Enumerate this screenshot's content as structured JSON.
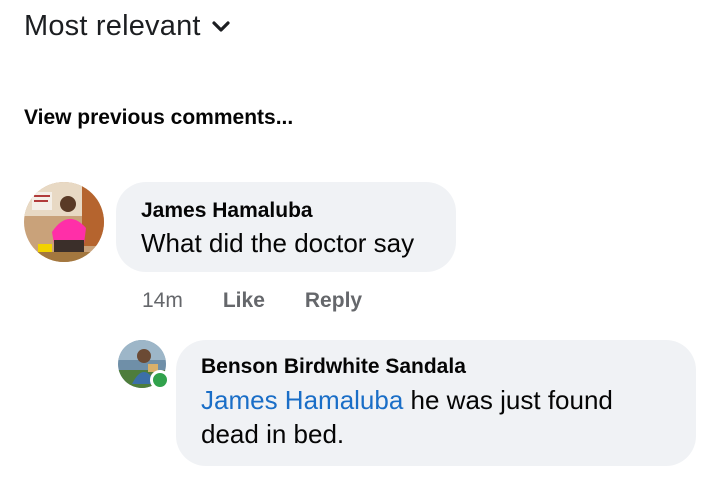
{
  "sort": {
    "label": "Most relevant",
    "icon": "chevron-down-icon"
  },
  "view_previous": "View previous comments...",
  "comments": [
    {
      "author": "James Hamaluba",
      "text": "What did the doctor say",
      "time": "14m",
      "like_label": "Like",
      "reply_label": "Reply",
      "avatar": "profile-photo"
    }
  ],
  "reply": {
    "author": "Benson Birdwhite Sandala",
    "mention": "James Hamaluba",
    "text": " he was just found dead in bed.",
    "online": true,
    "avatar": "profile-photo"
  },
  "colors": {
    "bubble": "#f0f2f5",
    "mention": "#1a6ec7",
    "meta": "#65676b",
    "online": "#31a24c"
  }
}
